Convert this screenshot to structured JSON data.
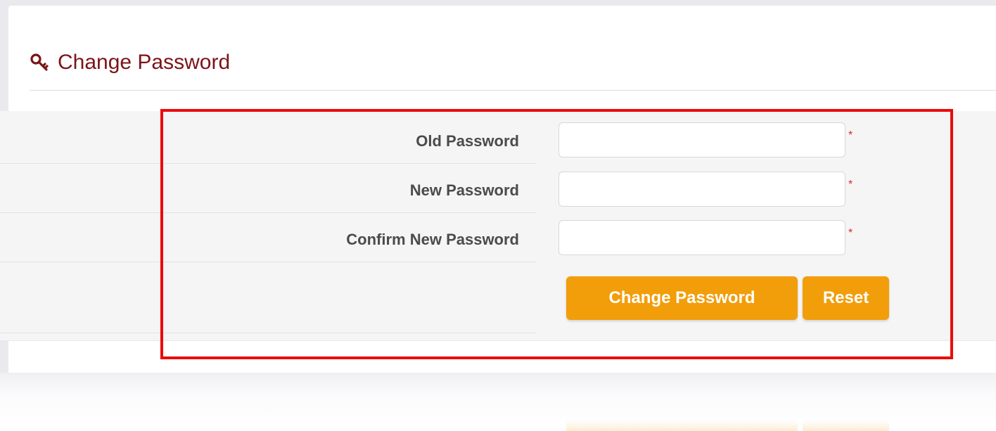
{
  "header": {
    "title": "Change Password",
    "icon": "key-icon",
    "title_color": "#7b1418"
  },
  "form": {
    "fields": [
      {
        "label": "Old Password",
        "value": "",
        "required_mark": "*"
      },
      {
        "label": "New Password",
        "value": "",
        "required_mark": "*"
      },
      {
        "label": "Confirm New Password",
        "value": "",
        "required_mark": "*"
      }
    ],
    "submit_label": "Change Password",
    "reset_label": "Reset",
    "button_color": "#f29e0b"
  },
  "highlight_color": "#ec0b0b"
}
